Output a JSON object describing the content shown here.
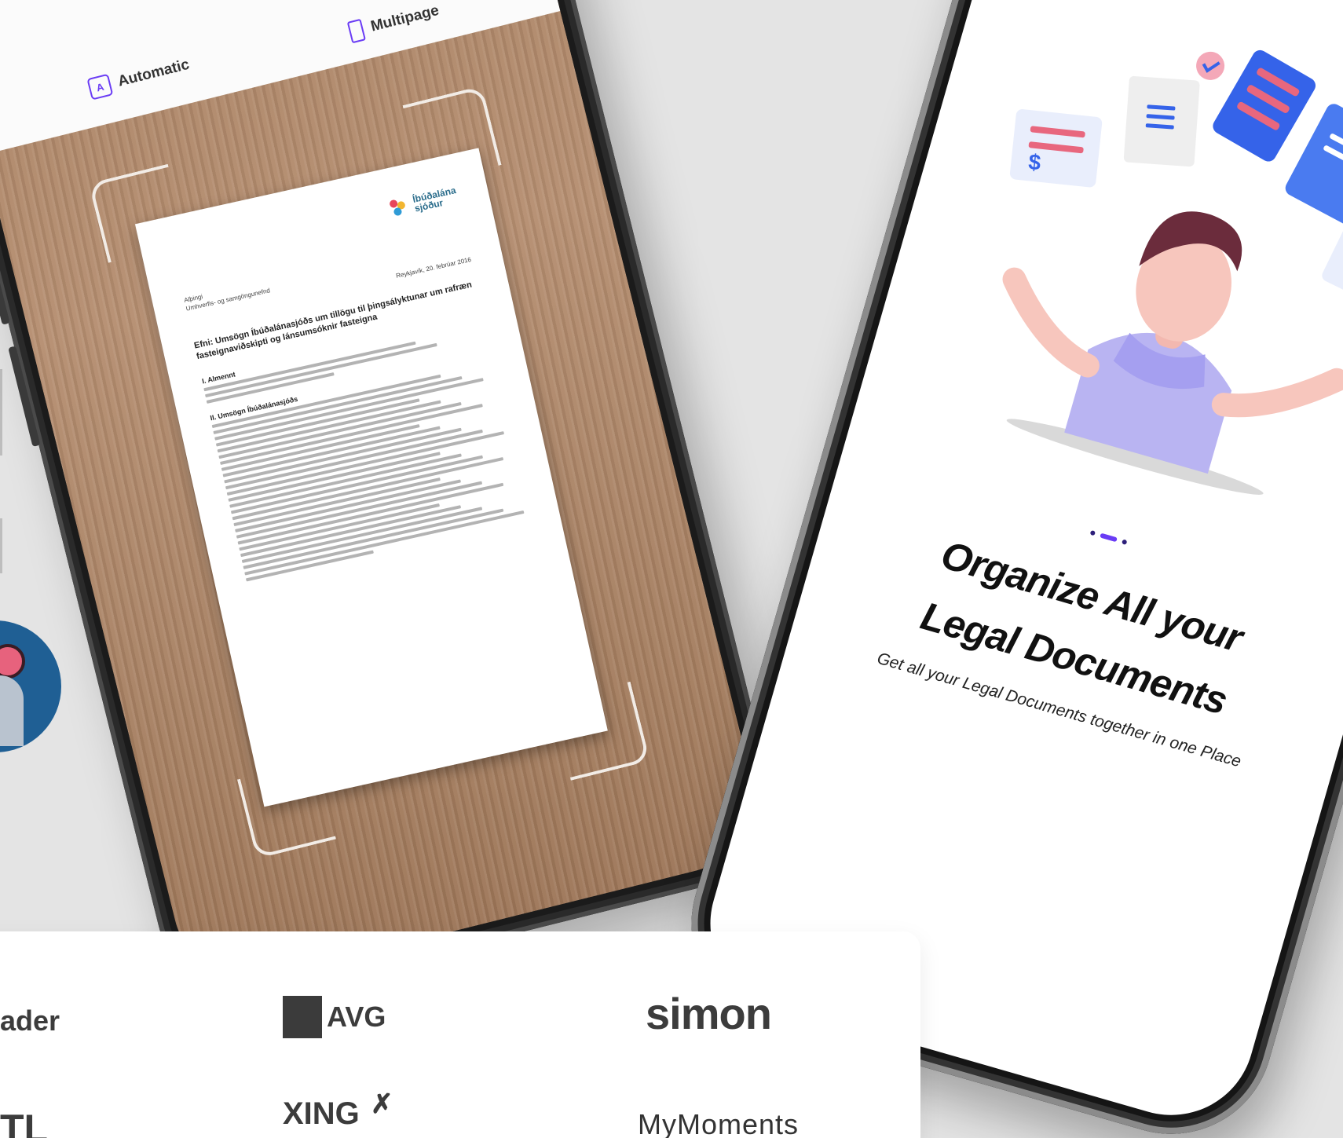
{
  "scanner": {
    "mode_auto_icon": "A",
    "mode_auto": "Automatic",
    "mode_multi": "Multipage",
    "document": {
      "logo_line1": "Íbúðalána",
      "logo_line2": "sjóður",
      "to_line1": "Alþingi",
      "to_line2": "Umhverfis- og samgöngunefnd",
      "date": "Reykjavík, 20. febrúar 2016",
      "subject": "Efni: Umsögn Íbúðalánasjóðs um tillögu til þingsályktunar um rafræn fasteignaviðskipti og lánsumsóknir fasteigna",
      "heading1": "I. Almennt",
      "heading2": "II. Umsögn Íbúðalánasjóðs"
    }
  },
  "onboarding": {
    "title_line1": "Organize All your",
    "title_line2": "Legal Documents",
    "subtitle": "Get all your Legal Documents together in one Place",
    "page_count": 3,
    "active_page": 2
  },
  "brands": {
    "reader": "ader",
    "avg": "AVG",
    "simon": "simon",
    "tl": "TL",
    "xing": "XING",
    "mymoments": "MyMoments"
  },
  "colors": {
    "accent": "#6a3cf5",
    "background": "#e4e4e4",
    "wood": "#a88061"
  }
}
